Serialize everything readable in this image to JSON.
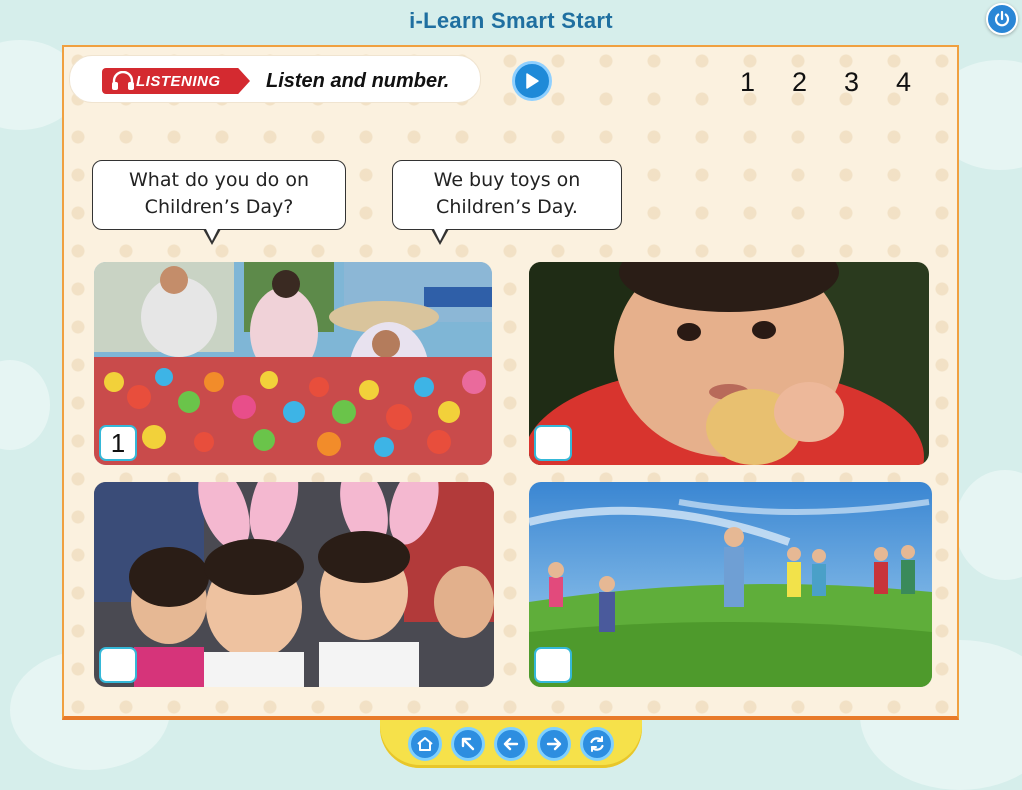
{
  "app": {
    "title": "i-Learn Smart Start"
  },
  "icons": {
    "power": "power-icon",
    "headphones": "headphones-icon",
    "play": "play-icon",
    "nav": [
      "home-icon",
      "arrow-up-left-icon",
      "arrow-left-icon",
      "arrow-right-icon",
      "refresh-icon"
    ]
  },
  "activity": {
    "skill": "LISTENING",
    "instruction": "Listen and number.",
    "number_options": [
      "1",
      "2",
      "3",
      "4"
    ]
  },
  "bubbles": [
    {
      "line1": "What do you do on",
      "line2": "Children’s Day?"
    },
    {
      "line1": "We buy toys on",
      "line2": "Children’s Day."
    }
  ],
  "photos": [
    {
      "subject": "people-buying-toys",
      "answer": "1"
    },
    {
      "subject": "child-eating-cookie",
      "answer": ""
    },
    {
      "subject": "children-bunny-ears",
      "answer": ""
    },
    {
      "subject": "children-playing-field",
      "answer": ""
    }
  ],
  "colors": {
    "background": "#d6eeeb",
    "title": "#1f6fa0",
    "panel_border": "#f0a040",
    "listening_tag": "#d42a30",
    "nav_bar": "#f6e14a",
    "button_blue": "#2d8ee0",
    "answer_border": "#35b8d8"
  }
}
